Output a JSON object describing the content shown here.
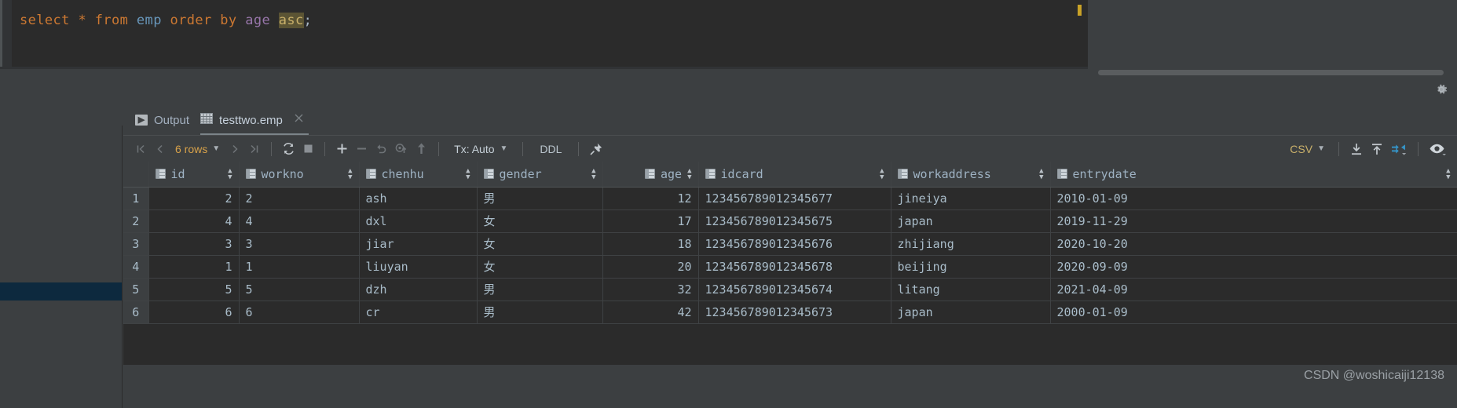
{
  "editor": {
    "sql_tokens": [
      {
        "t": "select",
        "k": "kw"
      },
      {
        "t": " ",
        "k": "punct"
      },
      {
        "t": "*",
        "k": "star"
      },
      {
        "t": " ",
        "k": "punct"
      },
      {
        "t": "from",
        "k": "kw"
      },
      {
        "t": " ",
        "k": "punct"
      },
      {
        "t": "emp",
        "k": "tbl"
      },
      {
        "t": " ",
        "k": "punct"
      },
      {
        "t": "order",
        "k": "kw"
      },
      {
        "t": " ",
        "k": "punct"
      },
      {
        "t": "by",
        "k": "kw"
      },
      {
        "t": " ",
        "k": "punct"
      },
      {
        "t": "age",
        "k": "col"
      },
      {
        "t": " ",
        "k": "punct"
      },
      {
        "t": "asc",
        "k": "sel"
      },
      {
        "t": ";",
        "k": "punct"
      }
    ],
    "sql_text": "select * from emp order by age asc;"
  },
  "tabs": [
    {
      "label": "Output",
      "icon": "console-icon",
      "active": false,
      "closable": false
    },
    {
      "label": "testtwo.emp",
      "icon": "table-icon",
      "active": true,
      "closable": true
    }
  ],
  "toolbar": {
    "first_page": "|<",
    "prev_page": "<",
    "rows_label": "6 rows",
    "rows_count": "6",
    "next_page": ">",
    "last_page": ">|",
    "refresh": "refresh-icon",
    "stop": "stop-icon",
    "add_row": "+",
    "delete_row": "−",
    "revert": "undo-icon",
    "revert_selected": "revert-selected-icon",
    "submit": "submit-icon",
    "tx_label": "Tx: Auto",
    "ddl_label": "DDL",
    "pin": "pin-icon",
    "format_label": "CSV",
    "export_icon": "download-icon",
    "import_icon": "upload-icon",
    "compare_icon": "data-extractor-icon",
    "view_icon": "eye-icon"
  },
  "grid": {
    "columns": [
      {
        "name": "id",
        "align": "right",
        "sortable": true
      },
      {
        "name": "workno",
        "align": "left",
        "sortable": true
      },
      {
        "name": "chenhu",
        "align": "left",
        "sortable": true
      },
      {
        "name": "gender",
        "align": "left",
        "sortable": true
      },
      {
        "name": "age",
        "align": "right",
        "sortable": true
      },
      {
        "name": "idcard",
        "align": "left",
        "sortable": true
      },
      {
        "name": "workaddress",
        "align": "left",
        "sortable": true
      },
      {
        "name": "entrydate",
        "align": "left",
        "sortable": true
      }
    ],
    "rows": [
      {
        "n": "1",
        "id": "2",
        "workno": "2",
        "chenhu": "ash",
        "gender": "男",
        "age": "12",
        "idcard": "123456789012345677",
        "workaddress": "jineiya",
        "entrydate": "2010-01-09"
      },
      {
        "n": "2",
        "id": "4",
        "workno": "4",
        "chenhu": "dxl",
        "gender": "女",
        "age": "17",
        "idcard": "123456789012345675",
        "workaddress": "japan",
        "entrydate": "2019-11-29"
      },
      {
        "n": "3",
        "id": "3",
        "workno": "3",
        "chenhu": "jiar",
        "gender": "女",
        "age": "18",
        "idcard": "123456789012345676",
        "workaddress": "zhijiang",
        "entrydate": "2020-10-20"
      },
      {
        "n": "4",
        "id": "1",
        "workno": "1",
        "chenhu": "liuyan",
        "gender": "女",
        "age": "20",
        "idcard": "123456789012345678",
        "workaddress": "beijing",
        "entrydate": "2020-09-09"
      },
      {
        "n": "5",
        "id": "5",
        "workno": "5",
        "chenhu": "dzh",
        "gender": "男",
        "age": "32",
        "idcard": "123456789012345674",
        "workaddress": "litang",
        "entrydate": "2021-04-09"
      },
      {
        "n": "6",
        "id": "6",
        "workno": "6",
        "chenhu": "cr",
        "gender": "男",
        "age": "42",
        "idcard": "123456789012345673",
        "workaddress": "japan",
        "entrydate": "2000-01-09"
      }
    ]
  },
  "watermark": "CSDN @woshicaiji12138",
  "colors": {
    "bg": "#3c3f41",
    "editor_bg": "#2b2b2b",
    "accent_blue": "#3592c4",
    "keyword_orange": "#cc7832",
    "selection": "#5b5434"
  }
}
